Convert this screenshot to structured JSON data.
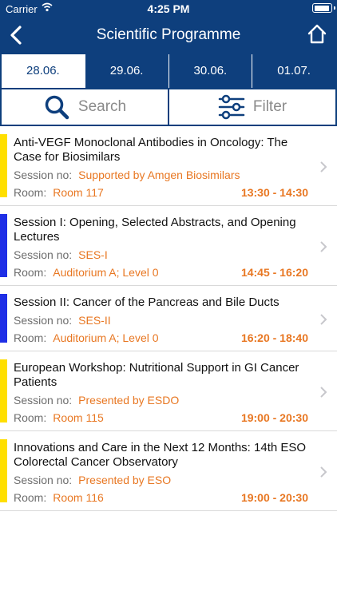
{
  "status_bar": {
    "carrier": "Carrier",
    "time": "4:25 PM"
  },
  "nav": {
    "title": "Scientific Programme"
  },
  "dates": [
    "28.06.",
    "29.06.",
    "30.06.",
    "01.07."
  ],
  "actions": {
    "search_label": "Search",
    "filter_label": "Filter"
  },
  "labels": {
    "session_no": "Session no:",
    "room": "Room:"
  },
  "colors": {
    "primary": "#0e3f7d",
    "accent": "#e87722",
    "yellow": "#ffdf00",
    "blue": "#1f2fe6"
  },
  "sessions": [
    {
      "title": "Anti-VEGF Monoclonal Antibodies in Oncology: The Case for Biosimilars",
      "session_no": "Supported by Amgen Biosimilars",
      "room": "Room 117",
      "time": "13:30 - 14:30",
      "color": "#ffdf00"
    },
    {
      "title": "Session I: Opening, Selected Abstracts, and Opening Lectures",
      "session_no": "SES-I",
      "room": "Auditorium A; Level 0",
      "time": "14:45 - 16:20",
      "color": "#1f2fe6"
    },
    {
      "title": "Session II: Cancer of the Pancreas and Bile Ducts",
      "session_no": "SES-II",
      "room": "Auditorium A; Level 0",
      "time": "16:20 - 18:40",
      "color": "#1f2fe6"
    },
    {
      "title": "European Workshop: Nutritional Support in GI Cancer Patients",
      "session_no": "Presented by ESDO",
      "room": "Room 115",
      "time": "19:00 - 20:30",
      "color": "#ffdf00"
    },
    {
      "title": "Innovations and Care in the Next 12 Months: 14th ESO Colorectal Cancer Observatory",
      "session_no": "Presented by ESO",
      "room": "Room 116",
      "time": "19:00 - 20:30",
      "color": "#ffdf00"
    }
  ]
}
